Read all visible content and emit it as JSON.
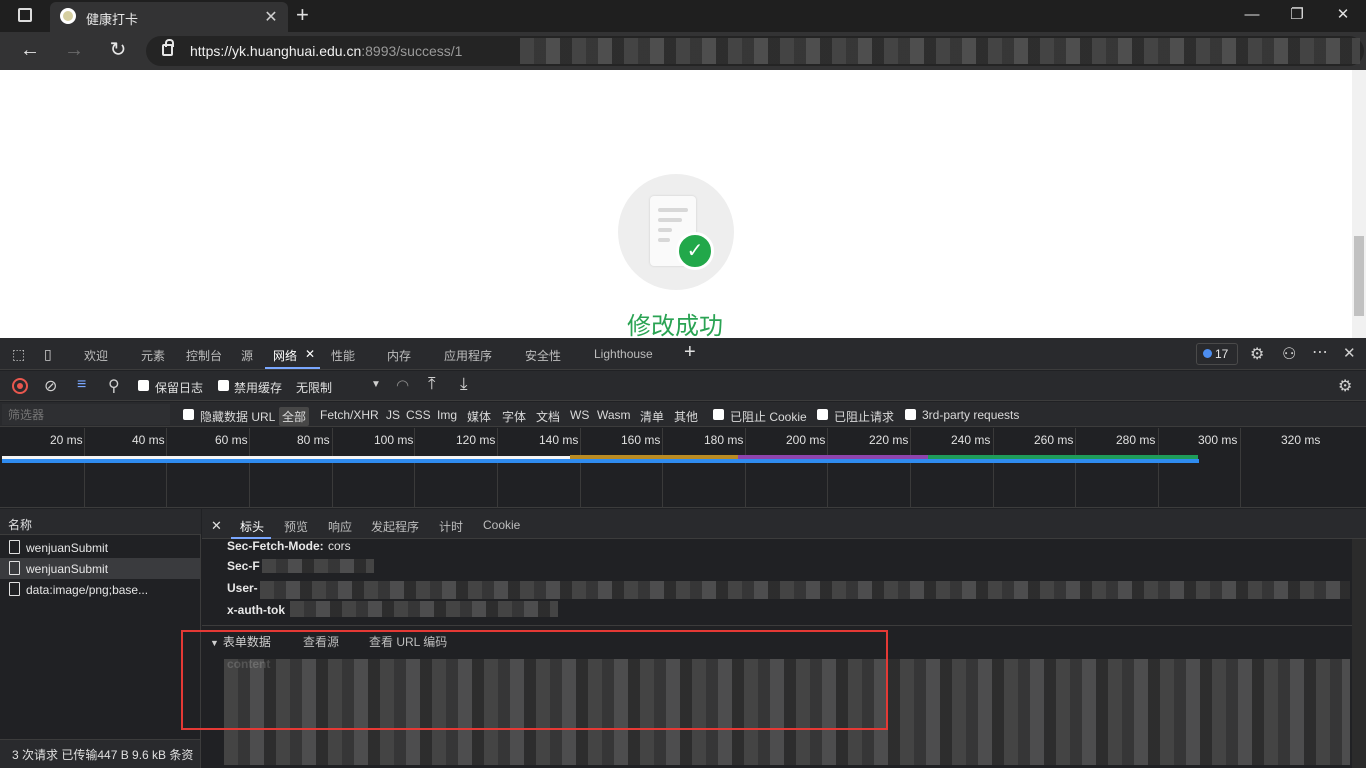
{
  "browser": {
    "tab_title": "健康打卡",
    "tab_close": "✕",
    "new_tab": "+",
    "url_main": "https://yk.huanghuai.edu.cn",
    "url_rest": ":8993/success/1",
    "window": {
      "minimize": "—",
      "restore": "❐",
      "close": "✕"
    },
    "nav": {
      "back": "←",
      "forward": "→",
      "reload": "↻"
    }
  },
  "page": {
    "success_text": "修改成功"
  },
  "devtools": {
    "tabs": [
      "欢迎",
      "元素",
      "控制台",
      "源",
      "网络",
      "性能",
      "内存",
      "应用程序",
      "安全性",
      "Lighthouse"
    ],
    "active_tab": "网络",
    "add_tab": "+",
    "issues_count": "17",
    "toolbar": {
      "preserve_log": "保留日志",
      "disable_cache": "禁用缓存",
      "throttle": "无限制"
    },
    "filter": {
      "placeholder": "筛选器",
      "hide_data_url": "隐藏数据 URL",
      "types": [
        "全部",
        "Fetch/XHR",
        "JS",
        "CSS",
        "Img",
        "媒体",
        "字体",
        "文档",
        "WS",
        "Wasm",
        "清单",
        "其他"
      ],
      "selected_type": "全部",
      "blocked_cookie": "已阻止 Cookie",
      "blocked_requests": "已阻止请求",
      "third_party": "3rd-party requests"
    },
    "timeline_ticks": [
      "20 ms",
      "40 ms",
      "60 ms",
      "80 ms",
      "100 ms",
      "120 ms",
      "140 ms",
      "160 ms",
      "180 ms",
      "200 ms",
      "220 ms",
      "240 ms",
      "260 ms",
      "280 ms",
      "300 ms",
      "320 ms"
    ],
    "request_list": {
      "header": "名称",
      "items": [
        "wenjuanSubmit",
        "wenjuanSubmit",
        "data:image/png;base..."
      ],
      "status": "3 次请求  已传输447 B  9.6 kB 条资"
    },
    "detail": {
      "tabs": [
        "标头",
        "预览",
        "响应",
        "发起程序",
        "计时",
        "Cookie"
      ],
      "active_tab": "标头",
      "headers": [
        {
          "key": "Sec-Fetch-Mode:",
          "value": "cors"
        },
        {
          "key": "Sec-F",
          "value": ""
        },
        {
          "key": "User-",
          "value": ""
        },
        {
          "key": "x-auth-tok",
          "value": ""
        }
      ],
      "form_section": "表单数据",
      "view_source": "查看源",
      "view_url_encoded": "查看 URL 编码",
      "form_key": "content"
    }
  }
}
